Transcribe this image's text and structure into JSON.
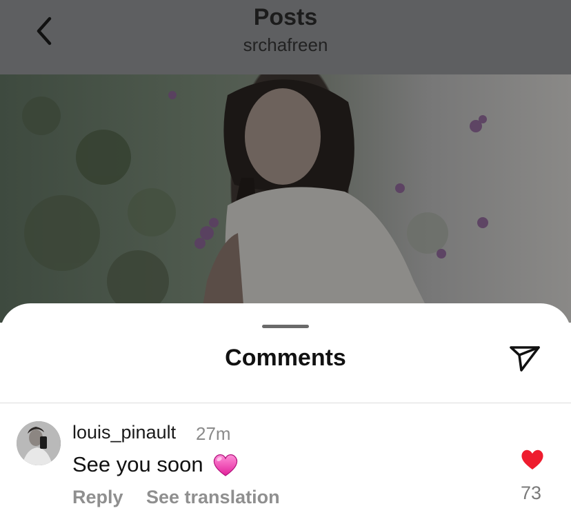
{
  "header": {
    "title": "Posts",
    "username": "srchafreen",
    "back_icon": "chevron-left-icon"
  },
  "photo": {
    "description": "post-image"
  },
  "sheet": {
    "title": "Comments",
    "send_icon": "send-icon"
  },
  "comments": [
    {
      "username": "louis_pinault",
      "time": "27m",
      "text": "See you soon",
      "emoji_icon": "pink-heart-emoji-icon",
      "reply_label": "Reply",
      "translate_label": "See translation",
      "like_icon": "heart-filled-icon",
      "like_count": "73"
    }
  ],
  "colors": {
    "header_overlay": "#5e5f61",
    "like_red": "#ee1c2e",
    "muted_text": "#8f8f8f"
  }
}
